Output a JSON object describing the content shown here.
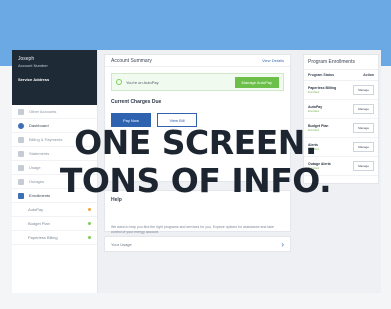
{
  "account_header": {
    "line1": "Joseph",
    "line2": "Account Number",
    "line3": "Service Address"
  },
  "nav": {
    "items": [
      {
        "label": "Other Accounts"
      },
      {
        "label": "Dashboard"
      },
      {
        "label": "Billing & Payments"
      },
      {
        "label": "Statements"
      },
      {
        "label": "Usage"
      },
      {
        "label": "Outages"
      },
      {
        "label": "Enrollments"
      }
    ],
    "sub_items": [
      {
        "label": "AutoPay",
        "status": "enrolled"
      },
      {
        "label": "Budget Plan",
        "status": "enrolled"
      },
      {
        "label": "Paperless Billing",
        "status": "enrolled"
      }
    ]
  },
  "summary": {
    "title": "Account Summary",
    "link": "View Details",
    "autopay_text": "You're on AutoPay",
    "autopay_button": "Manage AutoPay",
    "charges_title": "Current Charges Due",
    "pay_button": "Pay Now",
    "view_button": "View Bill"
  },
  "help": {
    "title": "Help",
    "body": "We want to help you find the right programs and services for you. Explore options for assistance and take control of your energy account."
  },
  "usage": {
    "label": "Your Usage",
    "chevron": "›"
  },
  "enrollments": {
    "title": "Program Enrollments",
    "col_program": "Program Status",
    "col_action": "Action",
    "rows": [
      {
        "name": "Paperless Billing",
        "status": "Enrolled",
        "action": "Manage"
      },
      {
        "name": "AutoPay",
        "status": "Enrolled",
        "action": "Manage"
      },
      {
        "name": "Budget Plan",
        "status": "Enrolled",
        "action": "Manage"
      },
      {
        "name": "Alerts",
        "status": "Enrolled",
        "action": "Manage"
      },
      {
        "name": "Outage Alerts",
        "status": "Enrolled",
        "action": "Manage"
      }
    ]
  },
  "headline": {
    "line1": "ONE SCREEN.",
    "line2": "TONS OF INFO."
  },
  "colors": {
    "accent_blue": "#2f63b0",
    "hero_blue": "#6aa9e3",
    "success_green": "#6cc04a",
    "sidebar_dark": "#1f2a37"
  }
}
